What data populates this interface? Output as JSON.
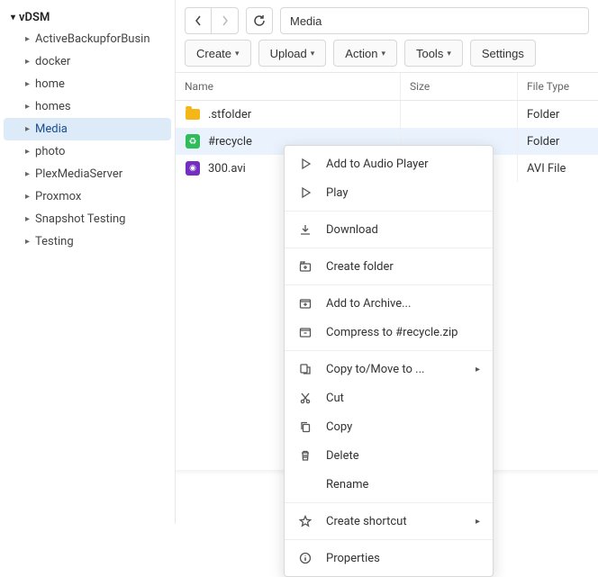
{
  "sidebar": {
    "root": "vDSM",
    "items": [
      {
        "label": "ActiveBackupforBusin"
      },
      {
        "label": "docker"
      },
      {
        "label": "home"
      },
      {
        "label": "homes"
      },
      {
        "label": "Media",
        "selected": true
      },
      {
        "label": "photo"
      },
      {
        "label": "PlexMediaServer"
      },
      {
        "label": "Proxmox"
      },
      {
        "label": "Snapshot Testing"
      },
      {
        "label": "Testing"
      }
    ]
  },
  "path": "Media",
  "buttons": {
    "create": "Create",
    "upload": "Upload",
    "action": "Action",
    "tools": "Tools",
    "settings": "Settings"
  },
  "columns": {
    "name": "Name",
    "size": "Size",
    "type": "File Type"
  },
  "files": [
    {
      "name": ".stfolder",
      "size": "",
      "type": "Folder",
      "icon": "folder"
    },
    {
      "name": "#recycle",
      "size": "",
      "type": "Folder",
      "icon": "recycle",
      "selected": true
    },
    {
      "name": "300.avi",
      "size": "",
      "type": "AVI File",
      "icon": "video"
    }
  ],
  "context_menu": [
    {
      "icon": "play-outline",
      "label": "Add to Audio Player"
    },
    {
      "icon": "play-outline",
      "label": "Play"
    },
    {
      "sep": true
    },
    {
      "icon": "download",
      "label": "Download"
    },
    {
      "sep": true
    },
    {
      "icon": "create-folder",
      "label": "Create folder"
    },
    {
      "sep": true
    },
    {
      "icon": "archive-add",
      "label": "Add to Archive..."
    },
    {
      "icon": "archive",
      "label": "Compress to #recycle.zip"
    },
    {
      "sep": true
    },
    {
      "icon": "copy-move",
      "label": "Copy to/Move to ...",
      "submenu": true
    },
    {
      "icon": "cut",
      "label": "Cut"
    },
    {
      "icon": "copy",
      "label": "Copy"
    },
    {
      "icon": "delete",
      "label": "Delete"
    },
    {
      "icon": "",
      "label": "Rename"
    },
    {
      "sep": true
    },
    {
      "icon": "star",
      "label": "Create shortcut",
      "submenu": true
    },
    {
      "sep": true
    },
    {
      "icon": "info",
      "label": "Properties"
    }
  ]
}
